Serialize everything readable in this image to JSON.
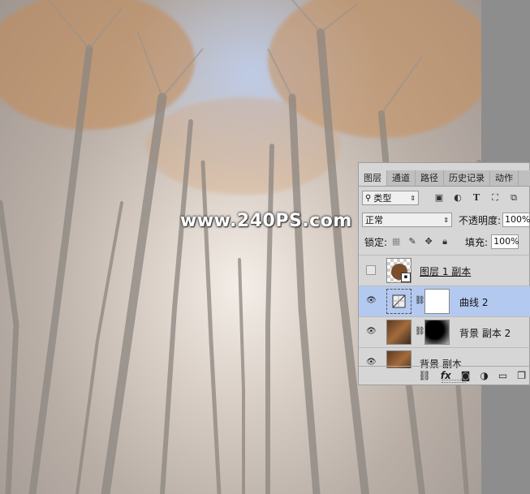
{
  "watermark": "www.240PS.com",
  "tabs": [
    "图层",
    "通道",
    "路径",
    "历史记录",
    "动作"
  ],
  "filter": {
    "label": "类型"
  },
  "blend": {
    "mode": "正常",
    "opacity_label": "不透明度:",
    "opacity_value": "100%"
  },
  "lock": {
    "label": "锁定:",
    "fill_label": "填充:",
    "fill_value": "100%"
  },
  "layers": [
    {
      "name": "图层 1 副本",
      "visible": false
    },
    {
      "name": "曲线 2",
      "visible": true,
      "selected": true
    },
    {
      "name": "背景 副本 2",
      "visible": true
    },
    {
      "name": "背景 副本",
      "visible": true
    }
  ],
  "icons": [
    "link-icon",
    "fx-icon",
    "add-mask-icon",
    "adjustment-icon",
    "group-folder-icon",
    "new-layer-icon"
  ],
  "colors": {
    "selected_row": "#b4c9ef",
    "panel_bg": "#d6d6d6"
  }
}
